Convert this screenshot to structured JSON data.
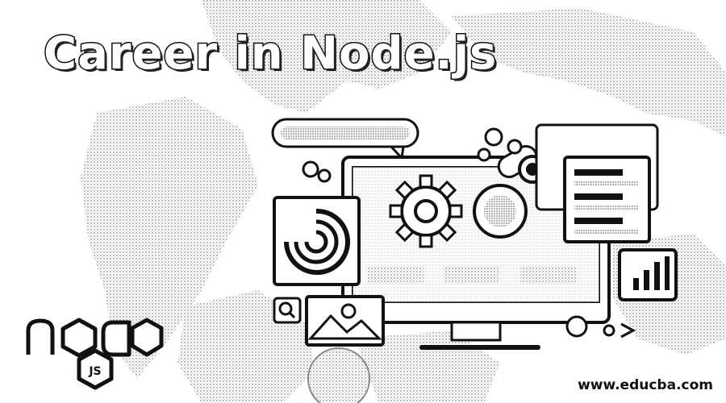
{
  "title": "Career in Node.js",
  "logo": {
    "wordmark": "node",
    "badge": "JS"
  },
  "watermark": "www.educba.com",
  "icons": [
    "node-logo-icon",
    "gear-icon",
    "chart-icon",
    "image-icon",
    "search-icon"
  ],
  "colors": {
    "ink": "#111111",
    "paper": "#ffffff",
    "dot": "#9a9a9a"
  }
}
